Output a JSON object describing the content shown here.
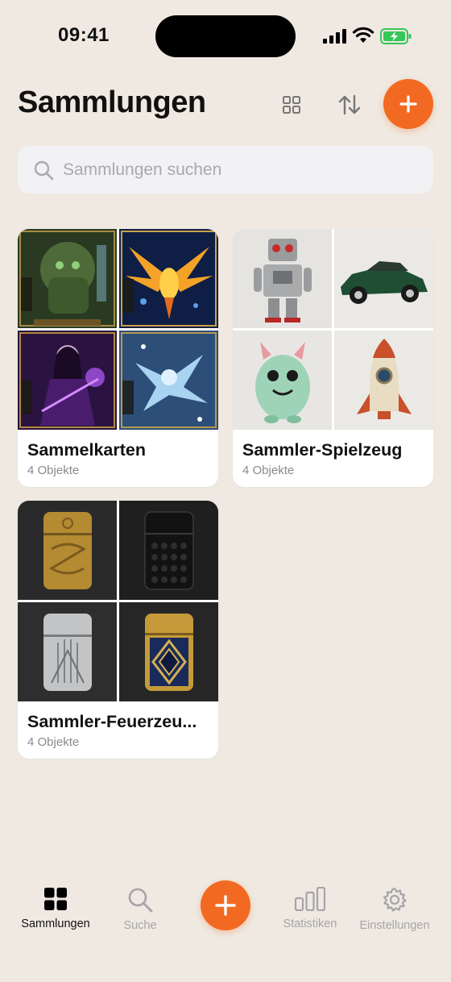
{
  "status_bar": {
    "time": "09:41"
  },
  "header": {
    "title": "Sammlungen"
  },
  "search": {
    "placeholder": "Sammlungen suchen"
  },
  "collections": [
    {
      "title": "Sammelkarten",
      "count": "4 Objekte",
      "items": [
        "forest-golem-card",
        "phoenix-card",
        "sorceress-card",
        "ice-dragon-card"
      ]
    },
    {
      "title": "Sammler-Spielzeug",
      "count": "4 Objekte",
      "items": [
        "tin-robot",
        "green-toy-car",
        "monster-plush",
        "toy-rocket"
      ]
    },
    {
      "title": "Sammler-Feuerzeu...",
      "count": "4 Objekte",
      "items": [
        "gold-engraved-lighter",
        "black-lighter",
        "silver-art-deco-lighter",
        "gold-blue-lighter"
      ]
    }
  ],
  "tab_bar": {
    "items": [
      {
        "label": "Sammlungen",
        "icon": "grid-icon",
        "active": true
      },
      {
        "label": "Suche",
        "icon": "search-icon",
        "active": false
      },
      {
        "label": "",
        "icon": "plus-icon",
        "active": false
      },
      {
        "label": "Statistiken",
        "icon": "chart-icon",
        "active": false
      },
      {
        "label": "Einstellungen",
        "icon": "gear-icon",
        "active": false
      }
    ]
  },
  "colors": {
    "background": "#efe9e1",
    "accent": "#f26a22",
    "inactive": "#a5a5aa"
  }
}
